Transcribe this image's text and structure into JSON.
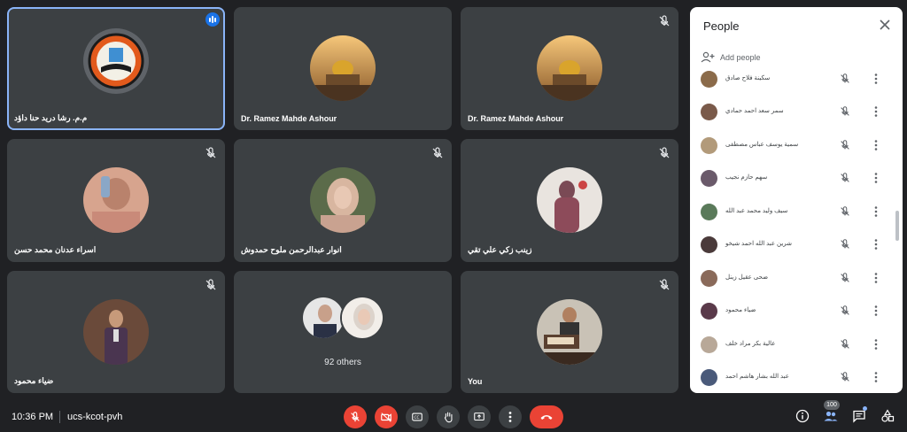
{
  "tiles": [
    {
      "name": "م.م. رشا دريد حنا داؤد",
      "mic": "speaking"
    },
    {
      "name": "Dr. Ramez Mahde Ashour",
      "mic": "on"
    },
    {
      "name": "Dr. Ramez Mahde Ashour",
      "mic": "off"
    },
    {
      "name": "اسراء عدنان محمد حسن",
      "mic": "off"
    },
    {
      "name": "انوار عبدالرحمن ملوح حمدوش",
      "mic": "off"
    },
    {
      "name": "زينب زكي علي تقي",
      "mic": "off"
    },
    {
      "name": "ضياء محمود",
      "mic": "off"
    },
    {
      "name": "92 others",
      "mic": "none"
    },
    {
      "name": "You",
      "mic": "off"
    }
  ],
  "panel": {
    "title": "People",
    "add_people": "Add people",
    "participants": [
      {
        "name": "سكينة فلاح صادق"
      },
      {
        "name": "سمر سعد احمد حمادي"
      },
      {
        "name": "سمية يوسف عباس مصطفى"
      },
      {
        "name": "سهم حازم نجيب"
      },
      {
        "name": "سيف وليد محمد عبد الله"
      },
      {
        "name": "شرين عبد الله احمد شيخو"
      },
      {
        "name": "ضحى عقيل زينل"
      },
      {
        "name": "ضياء محمود"
      },
      {
        "name": "عالية بكر مراد خلف"
      },
      {
        "name": "عبد الله بشار هاشم احمد"
      }
    ]
  },
  "bottom": {
    "time": "10:36 PM",
    "meeting_code": "ucs-kcot-pvh",
    "participant_count": "100"
  },
  "colors": {
    "background": "#202124",
    "tile": "#3c4043",
    "danger": "#ea4335",
    "accent": "#8ab4f8"
  }
}
